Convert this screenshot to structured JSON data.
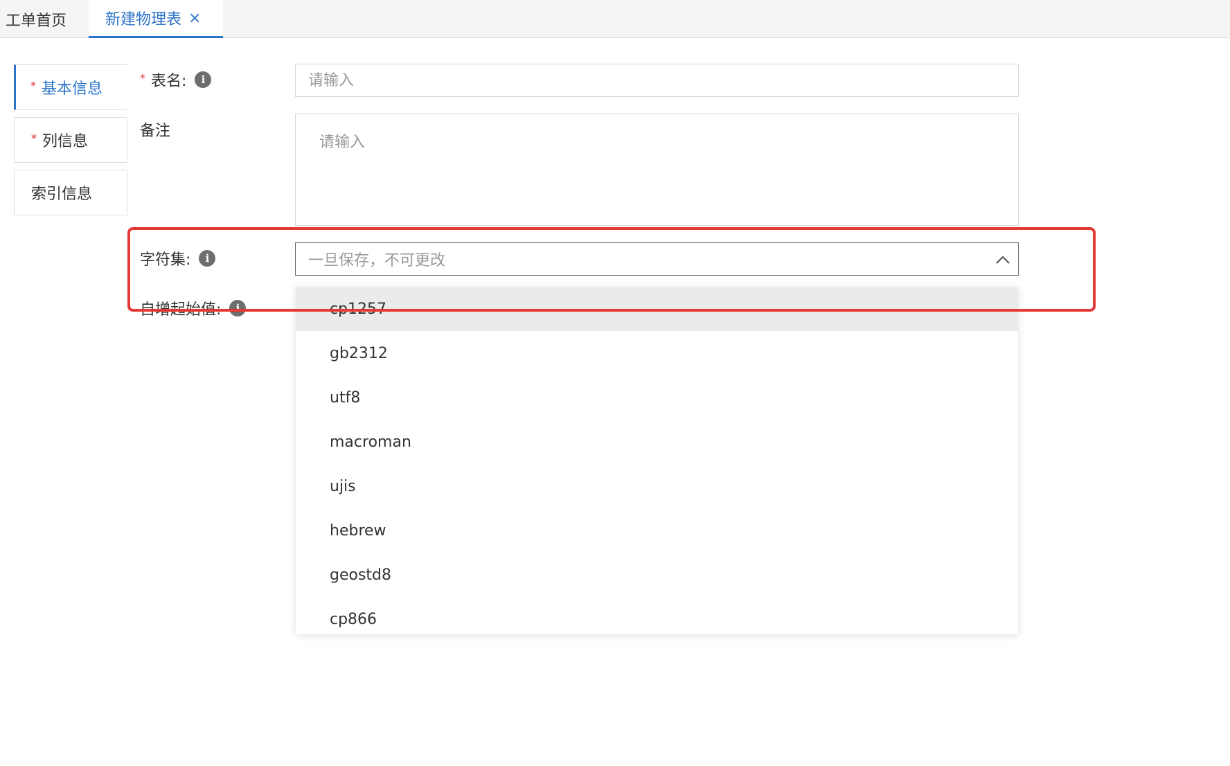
{
  "tabs": {
    "home_label": "工单首页",
    "active_label": "新建物理表",
    "close_glyph": "×"
  },
  "sidenav": {
    "items": [
      {
        "label": "基本信息",
        "required": "*"
      },
      {
        "label": "列信息",
        "required": "*"
      },
      {
        "label": "索引信息"
      }
    ]
  },
  "form": {
    "table_name": {
      "required": "*",
      "label": "表名:",
      "placeholder": "请输入",
      "value": ""
    },
    "remark": {
      "label": "备注",
      "placeholder": "请输入",
      "value": ""
    },
    "charset": {
      "label": "字符集:",
      "placeholder": "一旦保存，不可更改"
    },
    "auto_increment": {
      "label": "自增起始值:"
    },
    "info_glyph": "i"
  },
  "dropdown": {
    "options": [
      "cp1257",
      "gb2312",
      "utf8",
      "macroman",
      "ujis",
      "hebrew",
      "geostd8",
      "cp866"
    ],
    "highlighted": "cp1257"
  },
  "colors": {
    "accent": "#2a73c9",
    "required": "#e03232",
    "annotation": "#e53935"
  },
  "icons": {
    "info": "info-circle-icon",
    "dropdown_toggle": "chevron-up-icon",
    "tab_close": "close-icon"
  }
}
